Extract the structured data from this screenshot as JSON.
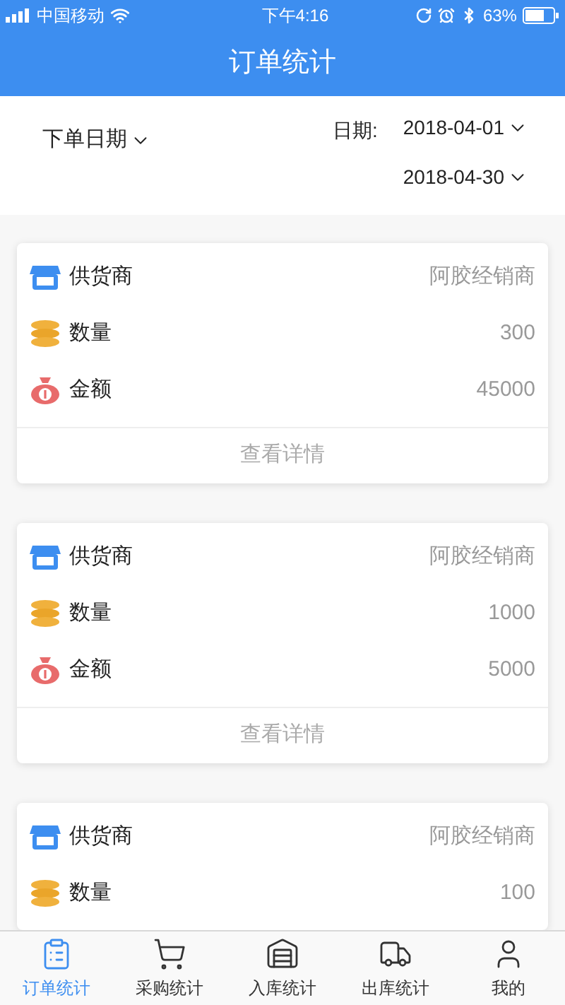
{
  "status_bar": {
    "carrier": "中国移动",
    "time": "下午4:16",
    "battery": "63%"
  },
  "header": {
    "title": "订单统计"
  },
  "filter": {
    "sort": "下单日期",
    "date_label": "日期:",
    "start_date": "2018-04-01",
    "end_date": "2018-04-30"
  },
  "cards": [
    {
      "rows": [
        {
          "kind": "supplier",
          "label": "供货商",
          "value": "阿胶经销商"
        },
        {
          "kind": "quantity",
          "label": "数量",
          "value": "300"
        },
        {
          "kind": "amount",
          "label": "金额",
          "value": "45000"
        }
      ],
      "details": "查看详情"
    },
    {
      "rows": [
        {
          "kind": "supplier",
          "label": "供货商",
          "value": "阿胶经销商"
        },
        {
          "kind": "quantity",
          "label": "数量",
          "value": "1000"
        },
        {
          "kind": "amount",
          "label": "金额",
          "value": "5000"
        }
      ],
      "details": "查看详情"
    },
    {
      "rows": [
        {
          "kind": "supplier",
          "label": "供货商",
          "value": "阿胶经销商"
        },
        {
          "kind": "quantity",
          "label": "数量",
          "value": "100"
        }
      ]
    }
  ],
  "tab_bar": [
    {
      "kind": "orders",
      "label": "订单统计",
      "selected": true
    },
    {
      "kind": "purchase",
      "label": "采购统计",
      "selected": false
    },
    {
      "kind": "inbound",
      "label": "入库统计",
      "selected": false
    },
    {
      "kind": "outbound",
      "label": "出库统计",
      "selected": false
    },
    {
      "kind": "profile",
      "label": "我的",
      "selected": false
    }
  ]
}
